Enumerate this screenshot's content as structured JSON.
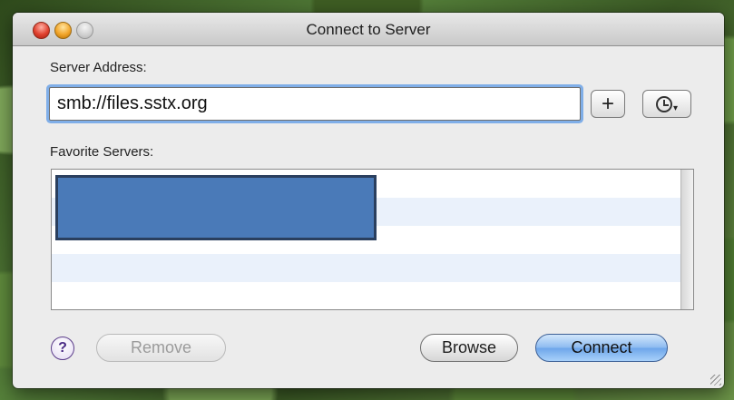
{
  "window": {
    "title": "Connect to Server"
  },
  "server": {
    "label": "Server Address:",
    "value": "smb://files.sstx.org"
  },
  "toolbar": {
    "add_label": "+",
    "recent_icon": "clock-icon"
  },
  "favorites": {
    "label": "Favorite Servers:"
  },
  "buttons": {
    "help_label": "?",
    "remove_label": "Remove",
    "browse_label": "Browse",
    "connect_label": "Connect"
  },
  "colors": {
    "accent": "#7faee8",
    "redaction": "#4a7ab8"
  }
}
